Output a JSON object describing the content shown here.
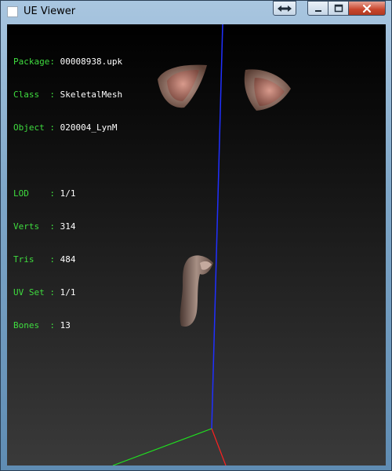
{
  "window": {
    "title": "UE Viewer",
    "buttons": {
      "extra_icon": "double-arrow-icon",
      "minimize_icon": "minimize-icon",
      "maximize_icon": "maximize-icon",
      "close_icon": "close-icon"
    },
    "colors": {
      "close_red": "#c8452c",
      "label_green": "#3fdc3f",
      "value_white": "#ffffff"
    }
  },
  "info": {
    "package_key": "Package:",
    "package_value": "00008938.upk",
    "class_key": "Class  :",
    "class_value": "SkeletalMesh",
    "object_key": "Object :",
    "object_value": "020004_LynM",
    "lod_key": "LOD    :",
    "lod_value": "1/1",
    "verts_key": "Verts  :",
    "verts_value": "314",
    "tris_key": "Tris   :",
    "tris_value": "484",
    "uvset_key": "UV Set :",
    "uvset_value": "1/1",
    "bones_key": "Bones  :",
    "bones_value": "13"
  },
  "scene": {
    "axis_colors": {
      "x": "#ff2020",
      "y": "#20e020",
      "z": "#2030ff"
    },
    "meshes": [
      "left-ear",
      "right-ear",
      "tail"
    ]
  }
}
